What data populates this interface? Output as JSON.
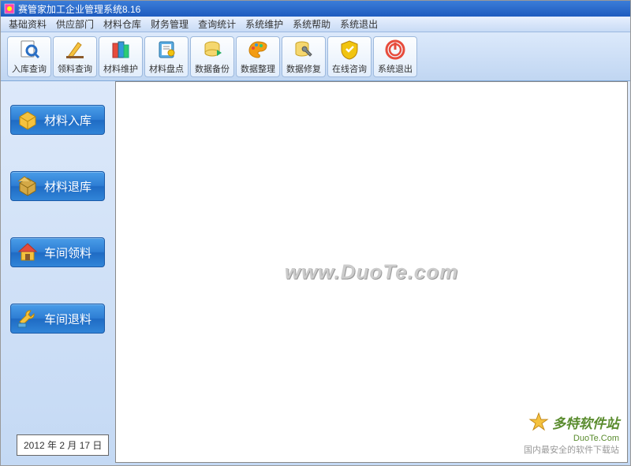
{
  "title": "赛管家加工企业管理系统8.16",
  "menu": {
    "items": [
      "基础资料",
      "供应部门",
      "材料仓库",
      "财务管理",
      "查询统计",
      "系统维护",
      "系统帮助",
      "系统退出"
    ]
  },
  "toolbar": {
    "buttons": [
      {
        "label": "入库查询",
        "icon": "search-doc"
      },
      {
        "label": "领料查询",
        "icon": "pencil"
      },
      {
        "label": "材料维护",
        "icon": "books"
      },
      {
        "label": "材料盘点",
        "icon": "notebook"
      },
      {
        "label": "数据备份",
        "icon": "db-yellow"
      },
      {
        "label": "数据整理",
        "icon": "palette"
      },
      {
        "label": "数据修复",
        "icon": "db-wrench"
      },
      {
        "label": "在线咨询",
        "icon": "shield"
      },
      {
        "label": "系统退出",
        "icon": "power"
      }
    ]
  },
  "sidebar": {
    "buttons": [
      {
        "label": "材料入库",
        "icon": "box-in"
      },
      {
        "label": "材料退库",
        "icon": "box-out"
      },
      {
        "label": "车间领料",
        "icon": "house"
      },
      {
        "label": "车间退料",
        "icon": "wrench"
      }
    ]
  },
  "date": "2012 年   2  月 17  日",
  "watermark": "www.DuoTe.com",
  "footer": {
    "brand": "多特软件站",
    "url": "DuoTe.Com",
    "sub": "国内最安全的软件下载站"
  }
}
